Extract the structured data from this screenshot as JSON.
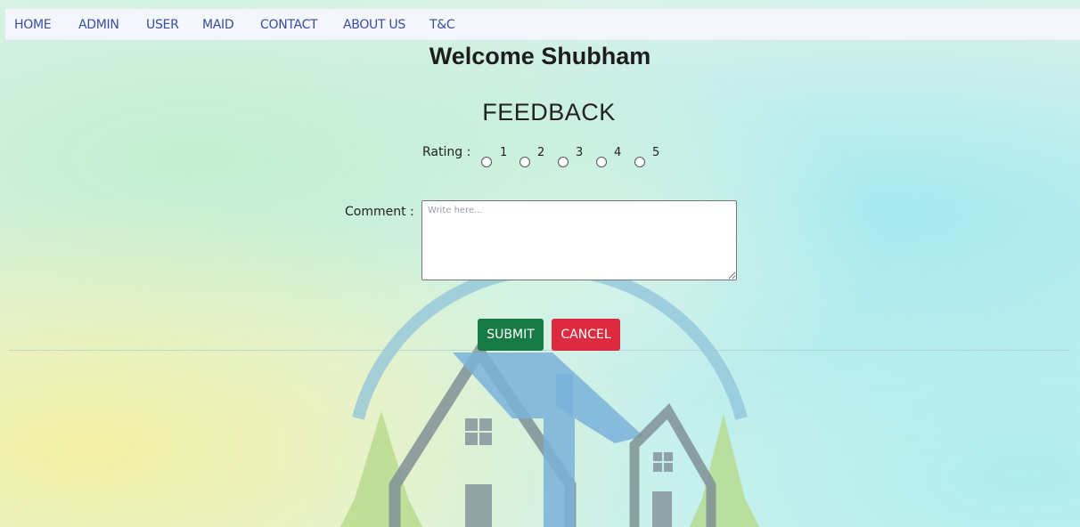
{
  "nav": {
    "items": [
      {
        "label": "HOME"
      },
      {
        "label": "ADMIN"
      },
      {
        "label": "USER"
      },
      {
        "label": "MAID"
      },
      {
        "label": "CONTACT"
      },
      {
        "label": "ABOUT US"
      },
      {
        "label": "T&C"
      }
    ]
  },
  "page": {
    "welcome": "Welcome Shubham",
    "title": "FEEDBACK"
  },
  "form": {
    "rating_label": "Rating :",
    "rating_options": [
      "1",
      "2",
      "3",
      "4",
      "5"
    ],
    "comment_label": "Comment :",
    "comment_placeholder": "Write here...",
    "comment_value": "",
    "submit_label": "SUBMIT",
    "cancel_label": "CANCEL"
  },
  "colors": {
    "submit": "#177a45",
    "cancel": "#dc2a3e",
    "nav_text": "#3a4da0"
  }
}
